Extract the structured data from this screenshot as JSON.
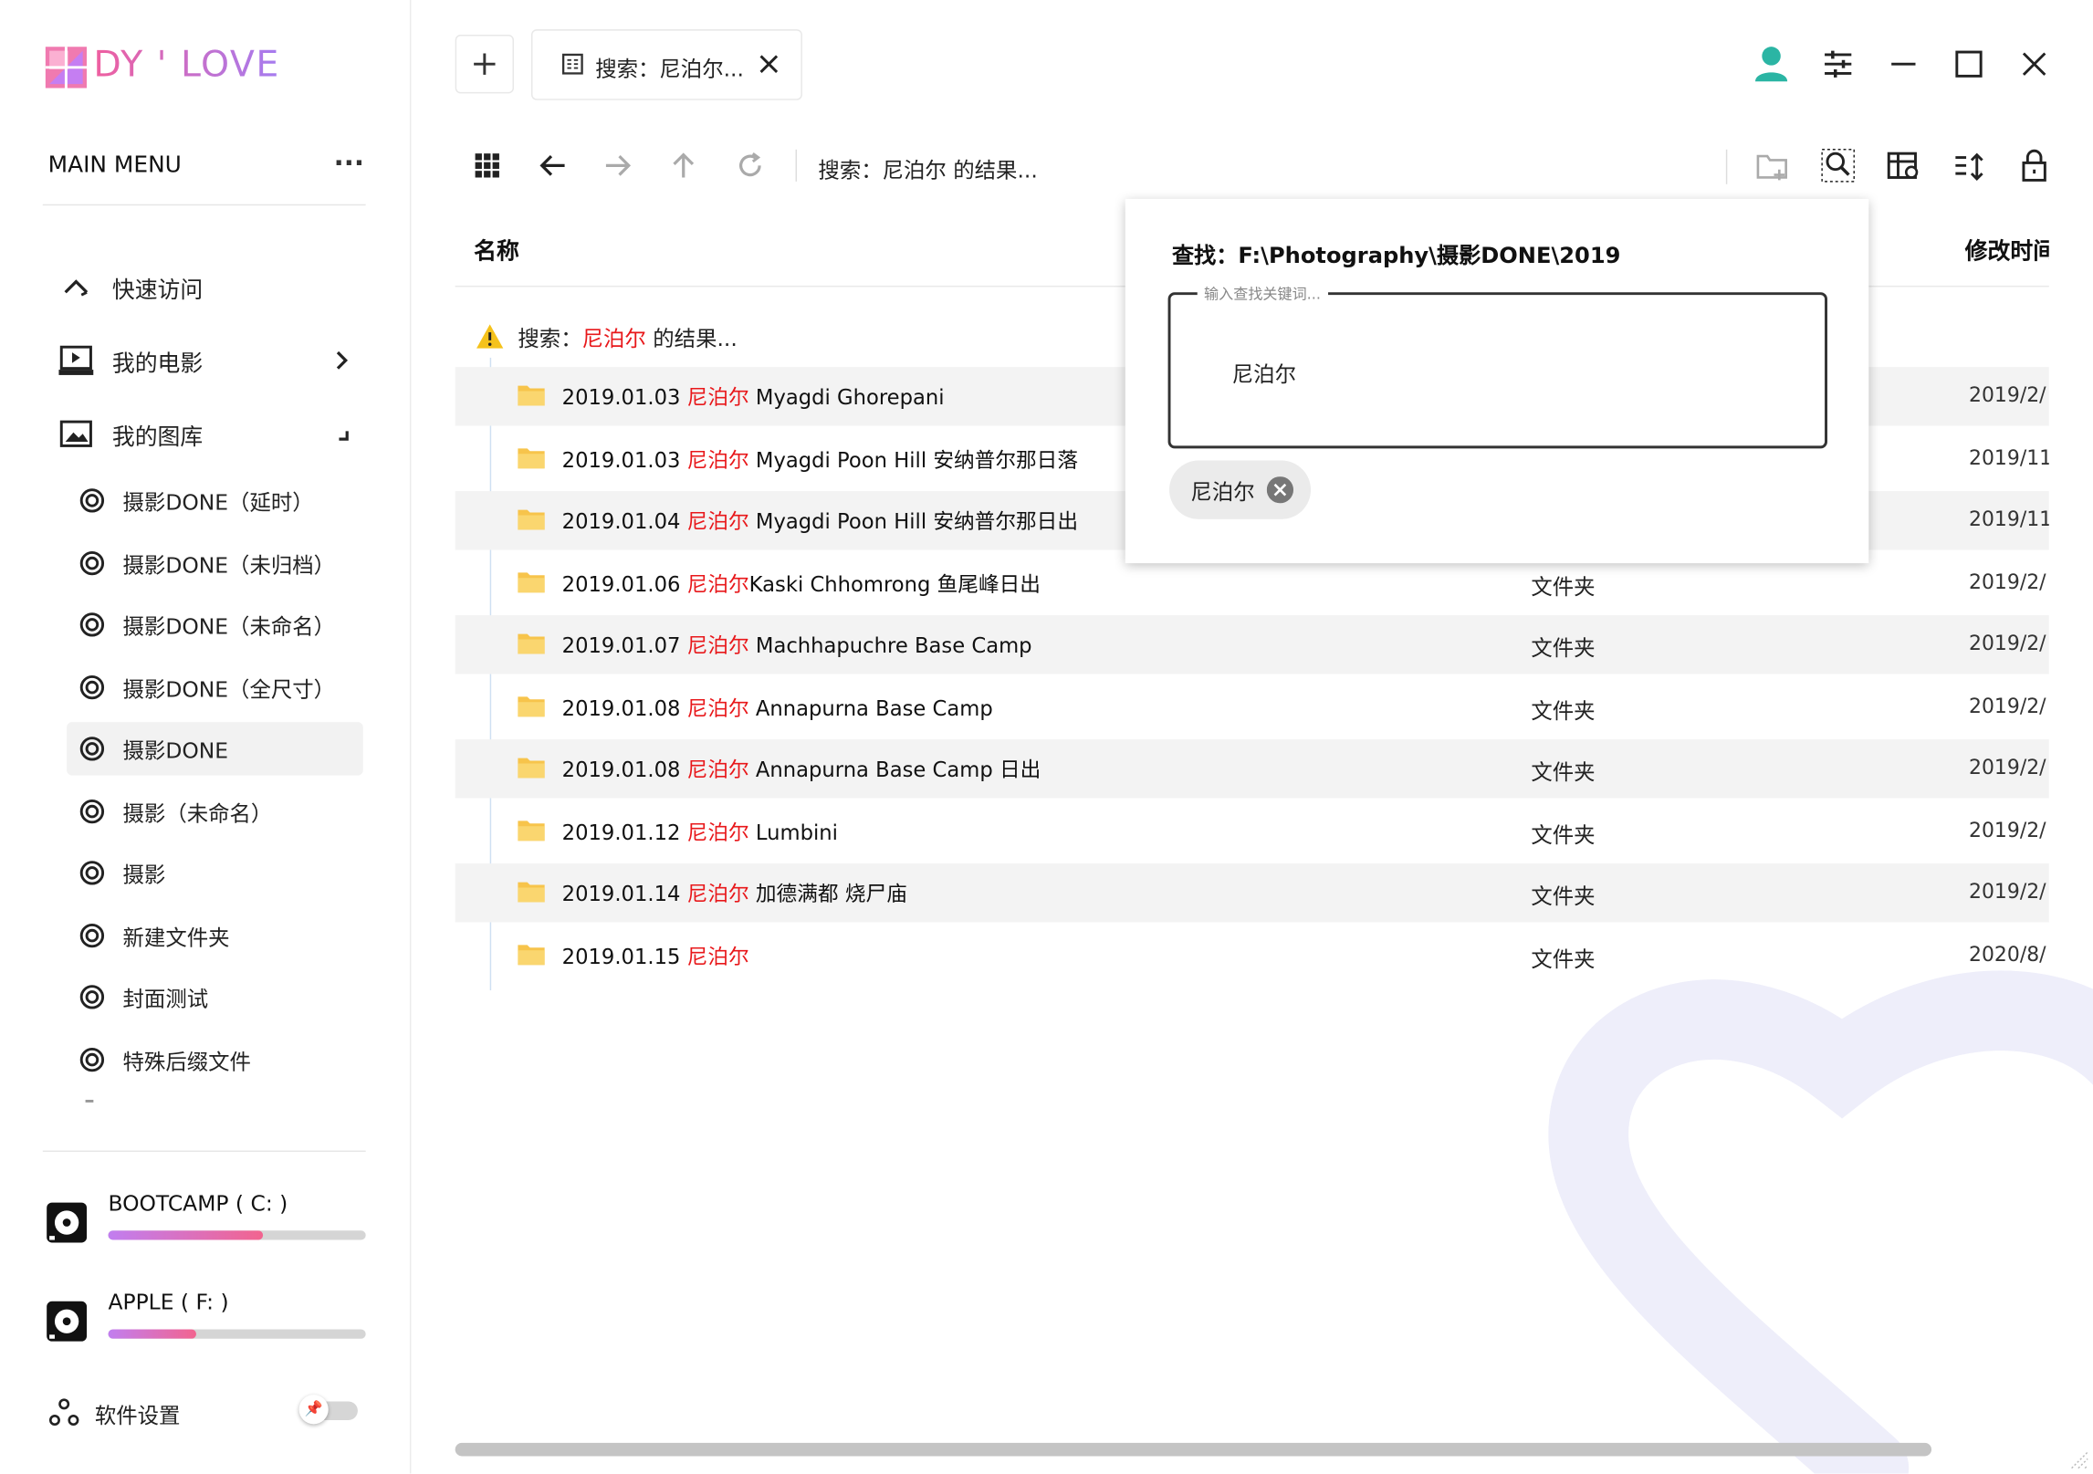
{
  "app": {
    "logo_text": "DY ' LOVE"
  },
  "sidebar": {
    "menu_title": "MAIN MENU",
    "nav": [
      {
        "label": "快速访问",
        "icon": "collapse-icon"
      },
      {
        "label": "我的电影",
        "icon": "movie-icon"
      },
      {
        "label": "我的图库",
        "icon": "gallery-icon"
      }
    ],
    "folders": [
      {
        "label": "摄影DONE（延时）"
      },
      {
        "label": "摄影DONE（未归档）"
      },
      {
        "label": "摄影DONE（未命名）"
      },
      {
        "label": "摄影DONE（全尺寸）"
      },
      {
        "label": "摄影DONE",
        "active": true
      },
      {
        "label": "摄影（未命名）"
      },
      {
        "label": "摄影"
      },
      {
        "label": "新建文件夹"
      },
      {
        "label": "封面测试"
      },
      {
        "label": "特殊后缀文件"
      }
    ],
    "drives": [
      {
        "name": "BOOTCAMP ( C: )",
        "usage": 0.6
      },
      {
        "name": "APPLE ( F: )",
        "usage": 0.34
      }
    ],
    "settings_label": "软件设置"
  },
  "tab": {
    "label": "搜索：尼泊尔..."
  },
  "toolbar": {
    "path_label": "搜索：尼泊尔 的结果..."
  },
  "table": {
    "col_name": "名称",
    "col_modified": "修改时间",
    "notice_prefix": "搜索：",
    "notice_keyword": "尼泊尔",
    "notice_suffix": " 的结果...",
    "rows": [
      {
        "date": "2019.01.03 ",
        "keyword": "尼泊尔",
        "rest": " Myagdi Ghorepani",
        "type": "",
        "modified": "2019/2/"
      },
      {
        "date": "2019.01.03 ",
        "keyword": "尼泊尔",
        "rest": " Myagdi Poon Hill 安纳普尔那日落",
        "type": "",
        "modified": "2019/11"
      },
      {
        "date": "2019.01.04 ",
        "keyword": "尼泊尔",
        "rest": " Myagdi Poon Hill 安纳普尔那日出",
        "type": "",
        "modified": "2019/11"
      },
      {
        "date": "2019.01.06 ",
        "keyword": "尼泊尔",
        "rest": "Kaski Chhomrong 鱼尾峰日出",
        "type": "文件夹",
        "modified": "2019/2/"
      },
      {
        "date": "2019.01.07 ",
        "keyword": "尼泊尔",
        "rest": " Machhapuchre Base Camp",
        "type": "文件夹",
        "modified": "2019/2/"
      },
      {
        "date": "2019.01.08 ",
        "keyword": "尼泊尔",
        "rest": " Annapurna Base Camp",
        "type": "文件夹",
        "modified": "2019/2/"
      },
      {
        "date": "2019.01.08 ",
        "keyword": "尼泊尔",
        "rest": " Annapurna Base Camp 日出",
        "type": "文件夹",
        "modified": "2019/2/"
      },
      {
        "date": "2019.01.12 ",
        "keyword": "尼泊尔",
        "rest": " Lumbini",
        "type": "文件夹",
        "modified": "2019/2/"
      },
      {
        "date": "2019.01.14 ",
        "keyword": "尼泊尔",
        "rest": " 加德满都 烧尸庙",
        "type": "文件夹",
        "modified": "2019/2/"
      },
      {
        "date": "2019.01.15 ",
        "keyword": "尼泊尔",
        "rest": "",
        "type": "文件夹",
        "modified": "2020/8/"
      }
    ]
  },
  "search_popup": {
    "title": "查找：F:\\Photography\\摄影DONE\\2019",
    "legend": "输入查找关键词...",
    "value": "尼泊尔",
    "chip_label": "尼泊尔"
  },
  "colors": {
    "accent_pink": "#f2648f",
    "accent_purple": "#c17ef0",
    "highlight_red": "#e8181b",
    "folder_yellow": "#f7c44b",
    "avatar_teal": "#2bb5a4"
  }
}
